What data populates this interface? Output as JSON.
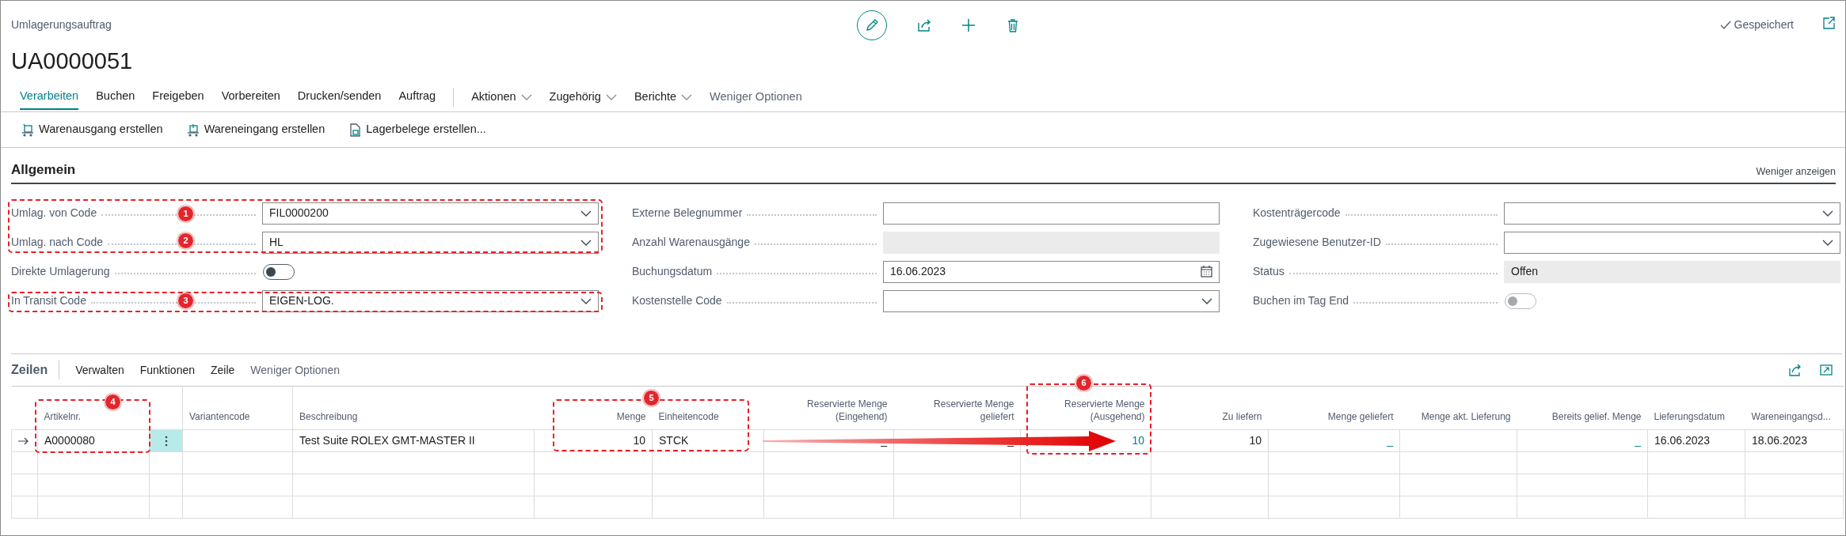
{
  "header": {
    "page_type": "Umlagerungsauftrag",
    "title": "UA0000051",
    "save_status": "Gespeichert"
  },
  "action_tabs": [
    {
      "label": "Verarbeiten",
      "selected": true
    },
    {
      "label": "Buchen",
      "selected": false
    },
    {
      "label": "Freigeben",
      "selected": false
    },
    {
      "label": "Vorbereiten",
      "selected": false
    },
    {
      "label": "Drucken/senden",
      "selected": false
    },
    {
      "label": "Auftrag",
      "selected": false
    }
  ],
  "action_menus": [
    {
      "label": "Aktionen"
    },
    {
      "label": "Zugehörig"
    },
    {
      "label": "Berichte"
    }
  ],
  "less_options": "Weniger Optionen",
  "subactions": [
    {
      "label": "Warenausgang erstellen",
      "kind": "shipment"
    },
    {
      "label": "Wareneingang erstellen",
      "kind": "receipt"
    },
    {
      "label": "Lagerbelege erstellen...",
      "kind": "document"
    }
  ],
  "general": {
    "title": "Allgemein",
    "toggle_label": "Weniger anzeigen",
    "columns": [
      [
        {
          "label": "Umlag. von Code",
          "kind": "dropdown",
          "value": "FIL0000200"
        },
        {
          "label": "Umlag. nach Code",
          "kind": "dropdown",
          "value": "HL"
        },
        {
          "label": "Direkte Umlagerung",
          "kind": "toggle",
          "on": false,
          "disabled": false
        },
        {
          "label": "In Transit Code",
          "kind": "dropdown",
          "value": "EIGEN-LOG."
        }
      ],
      [
        {
          "label": "Externe Belegnummer",
          "kind": "text"
        },
        {
          "label": "Anzahl Warenausgänge",
          "kind": "readonly"
        },
        {
          "label": "Buchungsdatum",
          "kind": "date",
          "value": "16.06.2023"
        },
        {
          "label": "Kostenstelle Code",
          "kind": "dropdown"
        }
      ],
      [
        {
          "label": "Kostenträgercode",
          "kind": "dropdown"
        },
        {
          "label": "Zugewiesene Benutzer-ID",
          "kind": "dropdown"
        },
        {
          "label": "Status",
          "kind": "readonly",
          "value": "Offen"
        },
        {
          "label": "Buchen im Tag End",
          "kind": "toggle",
          "on": false,
          "disabled": true
        }
      ]
    ]
  },
  "lines": {
    "title": "Zeilen",
    "menu": [
      "Verwalten",
      "Funktionen",
      "Zeile"
    ],
    "less_options": "Weniger Optionen",
    "columns": [
      {
        "label": "Artikelnr.",
        "kind": "text"
      },
      {
        "label": "Variantencode",
        "kind": "text"
      },
      {
        "label": "Beschreibung",
        "kind": "text"
      },
      {
        "label": "Menge",
        "kind": "number"
      },
      {
        "label": "Einheitencode",
        "kind": "text"
      },
      {
        "label": "Reservierte Menge (Eingehend)",
        "kind": "number"
      },
      {
        "label": "Reservierte Menge geliefert",
        "kind": "number"
      },
      {
        "label": "Reservierte Menge (Ausgehend)",
        "kind": "number"
      },
      {
        "label": "Zu liefern",
        "kind": "number"
      },
      {
        "label": "Menge geliefert",
        "kind": "number"
      },
      {
        "label": "Menge akt. Lieferung",
        "kind": "number"
      },
      {
        "label": "Bereits gelief. Menge",
        "kind": "number"
      },
      {
        "label": "Lieferungsdatum",
        "kind": "text"
      },
      {
        "label": "Wareneingangsd...",
        "kind": "text"
      }
    ],
    "rows": [
      {
        "current": true,
        "cells": [
          {
            "text": "A0000080"
          },
          {},
          {
            "text": "Test Suite ROLEX GMT-MASTER II"
          },
          {
            "text": "10"
          },
          {
            "text": "STCK"
          },
          {
            "text": "_"
          },
          {
            "text": "_"
          },
          {
            "text": "10",
            "link": true
          },
          {
            "text": "10"
          },
          {
            "text": "_",
            "link": true
          },
          {},
          {
            "text": "_",
            "link": true
          },
          {
            "text": "16.06.2023"
          },
          {
            "text": "18.06.2023"
          }
        ]
      }
    ]
  },
  "callouts": [
    {
      "number": "1"
    },
    {
      "number": "2"
    },
    {
      "number": "3"
    },
    {
      "number": "4"
    },
    {
      "number": "5"
    },
    {
      "number": "6"
    }
  ]
}
